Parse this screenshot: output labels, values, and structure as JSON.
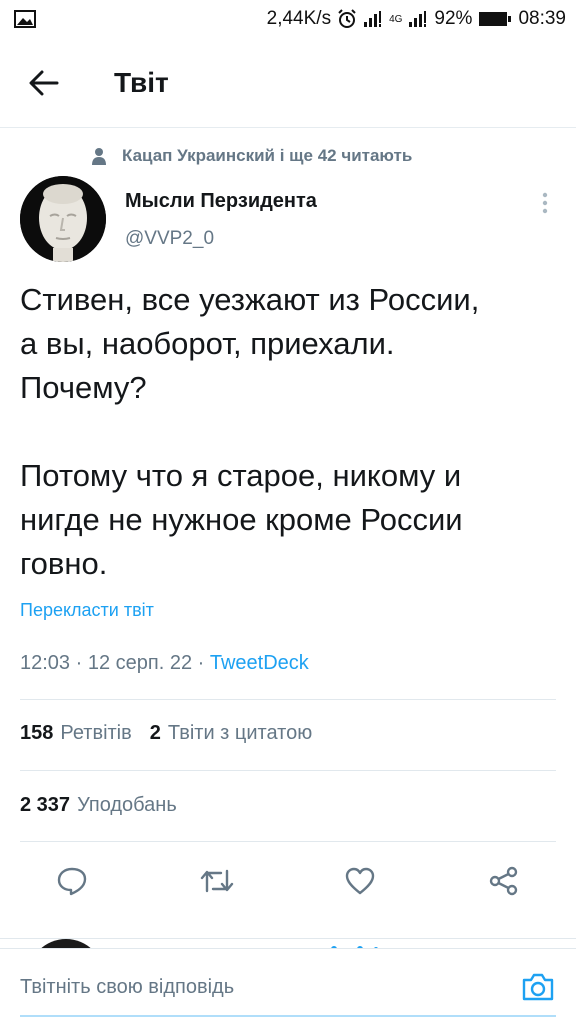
{
  "status_bar": {
    "net_speed": "2,44K/s",
    "network_label": "4G",
    "battery": "92%",
    "time": "08:39"
  },
  "header": {
    "title": "Твіт"
  },
  "social_context": {
    "text": "Кацап Украинский і ще 42 читають"
  },
  "tweet": {
    "author_name": "Мысли Перзидента",
    "author_handle": "@VVP2_0",
    "text_lines": [
      "Стивен, все уезжают из России,",
      "а вы, наоборот, приехали.",
      "Почему?",
      "Потому что я старое, никому и",
      "нигде не нужное кроме России",
      "говно."
    ],
    "translate_label": "Перекласти твіт",
    "time": "12:03",
    "date": "12 серп. 22",
    "separator": "·",
    "source": "TweetDeck"
  },
  "stats": {
    "retweets_count": "158",
    "retweets_label": "Ретвітів",
    "quotes_count": "2",
    "quotes_label": "Твіти з цитатою",
    "likes_count": "2 337",
    "likes_label": "Уподобань"
  },
  "actions": [
    "reply-icon",
    "retweet-icon",
    "like-icon",
    "share-icon"
  ],
  "reply_bar": {
    "placeholder": "Твітніть свою відповідь"
  },
  "colors": {
    "accent": "#1da1f2",
    "secondary_text": "#657786",
    "primary_text": "#14171a",
    "divider": "#e1e8ed"
  }
}
